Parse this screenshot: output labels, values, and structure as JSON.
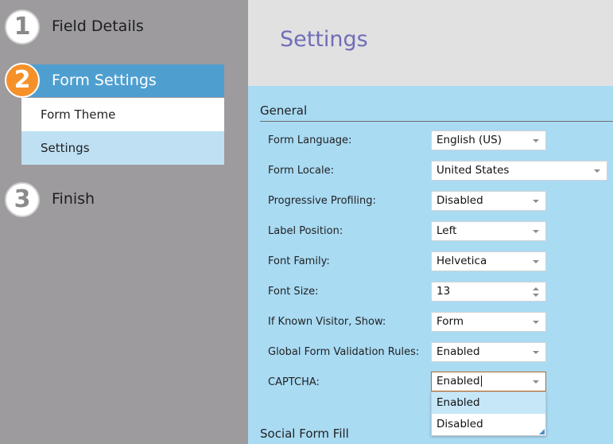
{
  "steps": [
    {
      "number": "1",
      "label": "Field Details"
    },
    {
      "number": "2",
      "label": "Form Settings"
    },
    {
      "number": "3",
      "label": "Finish"
    }
  ],
  "substeps": {
    "theme": "Form Theme",
    "settings": "Settings"
  },
  "main": {
    "title": "Settings"
  },
  "general": {
    "title": "General",
    "rows": [
      {
        "label": "Form Language:",
        "value": "English (US)"
      },
      {
        "label": "Form Locale:",
        "value": "United States"
      },
      {
        "label": "Progressive Profiling:",
        "value": "Disabled"
      },
      {
        "label": "Label Position:",
        "value": "Left"
      },
      {
        "label": "Font Family:",
        "value": "Helvetica"
      },
      {
        "label": "Font Size:",
        "value": "13"
      },
      {
        "label": "If Known Visitor, Show:",
        "value": "Form"
      },
      {
        "label": "Global Form Validation Rules:",
        "value": "Enabled"
      },
      {
        "label": "CAPTCHA:",
        "value": "Enabled"
      }
    ]
  },
  "captcha_options": [
    "Enabled",
    "Disabled"
  ],
  "social": {
    "title": "Social Form Fill"
  },
  "colors": {
    "accent": "#4e9fd0",
    "step_active": "#f6912a",
    "title": "#6f6eb8",
    "panel": "#a9dbf3"
  }
}
